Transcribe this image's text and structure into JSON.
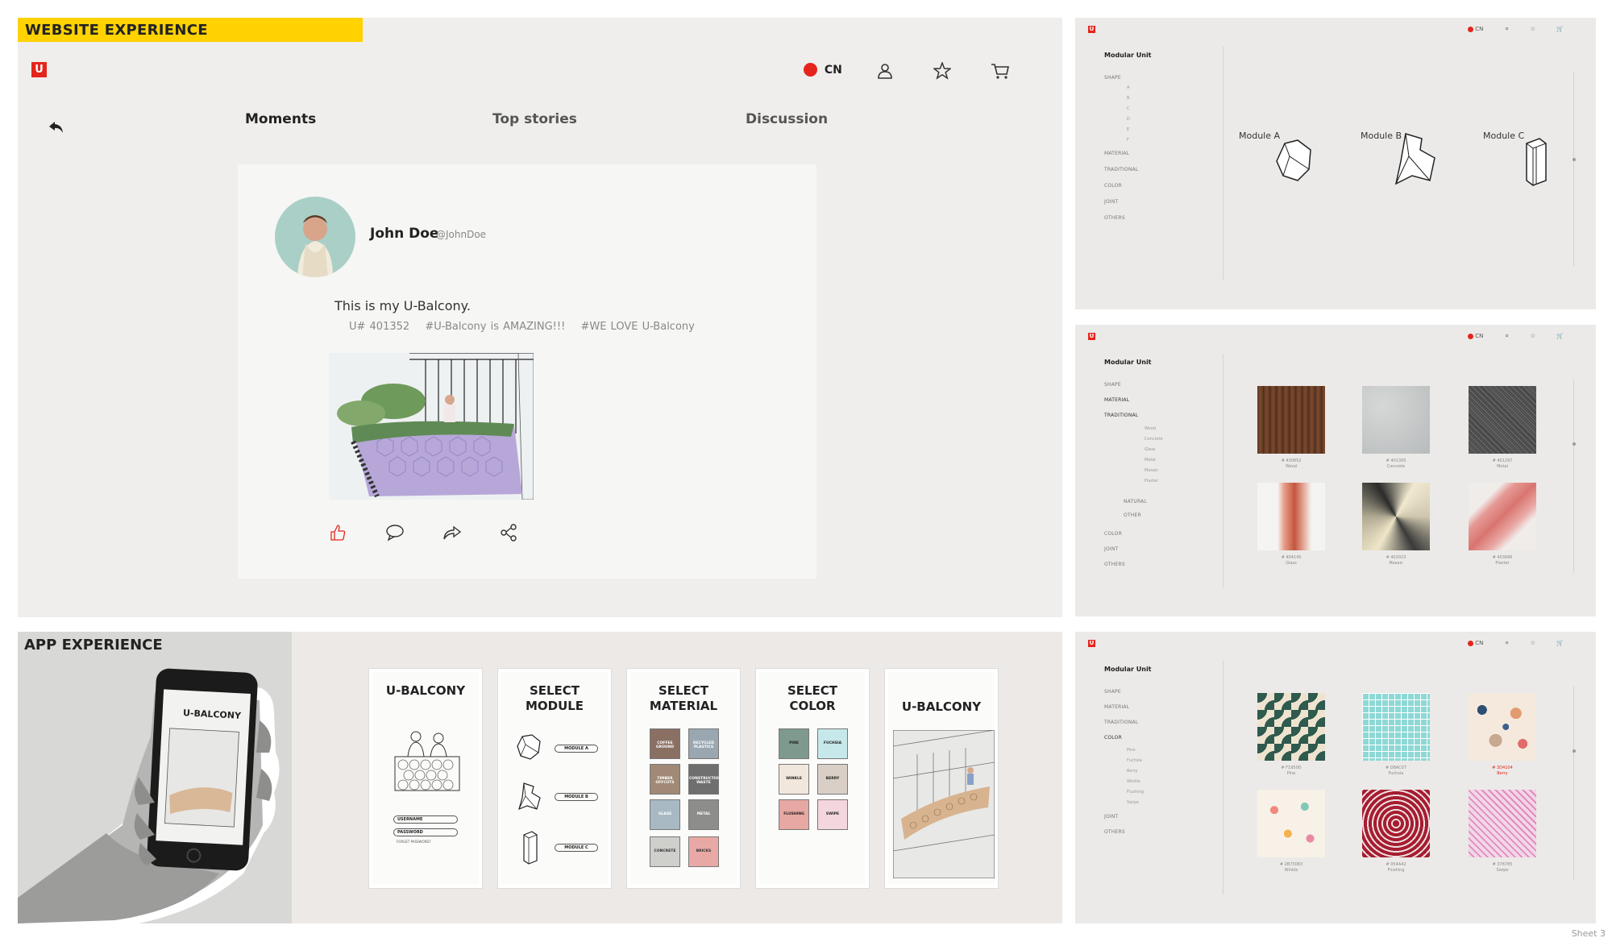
{
  "sheet_label": "Sheet 3",
  "brand": {
    "logo_letter": "U",
    "accent": "#e5251c",
    "tag_color": "#ffd200"
  },
  "website": {
    "section_label": "WEBSITE EXPERIENCE",
    "lang": "CN",
    "tabs": [
      "Moments",
      "Top stories",
      "Discussion"
    ],
    "active_tab": "Moments",
    "post": {
      "user_name": "John Doe",
      "handle": "@JohnDoe",
      "text": "This is my U-Balcony.",
      "tags": [
        "U# 401352",
        "#U-Balcony is AMAZING!!!",
        "#WE LOVE U-Balcony"
      ],
      "actions": [
        "like-icon",
        "comment-icon",
        "repost-icon",
        "share-icon"
      ]
    }
  },
  "app": {
    "section_label": "APP EXPERIENCE",
    "phone_title": "U-BALCONY",
    "screens": {
      "login": {
        "title": "U-BALCONY",
        "fields": [
          "USERNAME",
          "PASSWORD"
        ],
        "forgot": "FORGET PASSWORD?"
      },
      "module": {
        "title_1": "SELECT",
        "title_2": "MODULE",
        "options": [
          "MODULE A",
          "MODULE B",
          "MODULE C"
        ]
      },
      "material": {
        "title_1": "SELECT",
        "title_2": "MATERIAL",
        "options": [
          "COFFEE GROUND",
          "RECYCLED PLASTICS",
          "TIMBER OFFCUTS",
          "CONSTRUCTION WASTE",
          "GLASS",
          "METAL",
          "CONCRETE",
          "BRICKS"
        ]
      },
      "color": {
        "title_1": "SELECT",
        "title_2": "COLOR",
        "options": [
          "PINE",
          "FUCHSIA",
          "WINKLE",
          "BERRY",
          "FLUSHING",
          "SWIPE"
        ]
      },
      "result": {
        "title": "U-BALCONY"
      }
    }
  },
  "side_common": {
    "lang": "CN",
    "title": "Modular Unit"
  },
  "side1": {
    "menu": [
      "SHAPE",
      "MATERIAL",
      "TRADITIONAL",
      "COLOR",
      "JOINT",
      "OTHERS"
    ],
    "shape_sub": [
      "A",
      "B",
      "C",
      "D",
      "E",
      "F"
    ],
    "modules": [
      "Module A",
      "Module B",
      "Module C"
    ]
  },
  "side2": {
    "menu": [
      "SHAPE",
      "MATERIAL",
      "TRADITIONAL"
    ],
    "sub": [
      "Wood",
      "Concrete",
      "Glass",
      "Metal",
      "Mosaic",
      "Plaster"
    ],
    "menu2": [
      "NATURAL",
      "OTHER"
    ],
    "menu3": [
      "COLOR",
      "JOINT",
      "OTHERS"
    ],
    "tiles": [
      {
        "code": "# 430852",
        "name": "Wood"
      },
      {
        "code": "# 401305",
        "name": "Concrete"
      },
      {
        "code": "# 401297",
        "name": "Metal"
      },
      {
        "code": "# 404145",
        "name": "Glass"
      },
      {
        "code": "# 402023",
        "name": "Mosaic"
      },
      {
        "code": "# 403686",
        "name": "Plaster"
      }
    ]
  },
  "side3": {
    "menu": [
      "SHAPE",
      "MATERIAL",
      "TRADITIONAL",
      "COLOR"
    ],
    "sub": [
      "Pine",
      "Fuchsia",
      "Berry",
      "Winkle",
      "Flushing",
      "Swipe"
    ],
    "menu2": [
      "JOINT",
      "OTHERS"
    ],
    "tiles": [
      {
        "code": "# F1950D",
        "name": "Pine"
      },
      {
        "code": "# D8AC07",
        "name": "Fuchsia"
      },
      {
        "code": "# 3D4104",
        "name": "Berry"
      },
      {
        "code": "# 2B73083",
        "name": "Winkle"
      },
      {
        "code": "# 054A42",
        "name": "Flushing"
      },
      {
        "code": "# 376785",
        "name": "Swipe"
      }
    ]
  }
}
